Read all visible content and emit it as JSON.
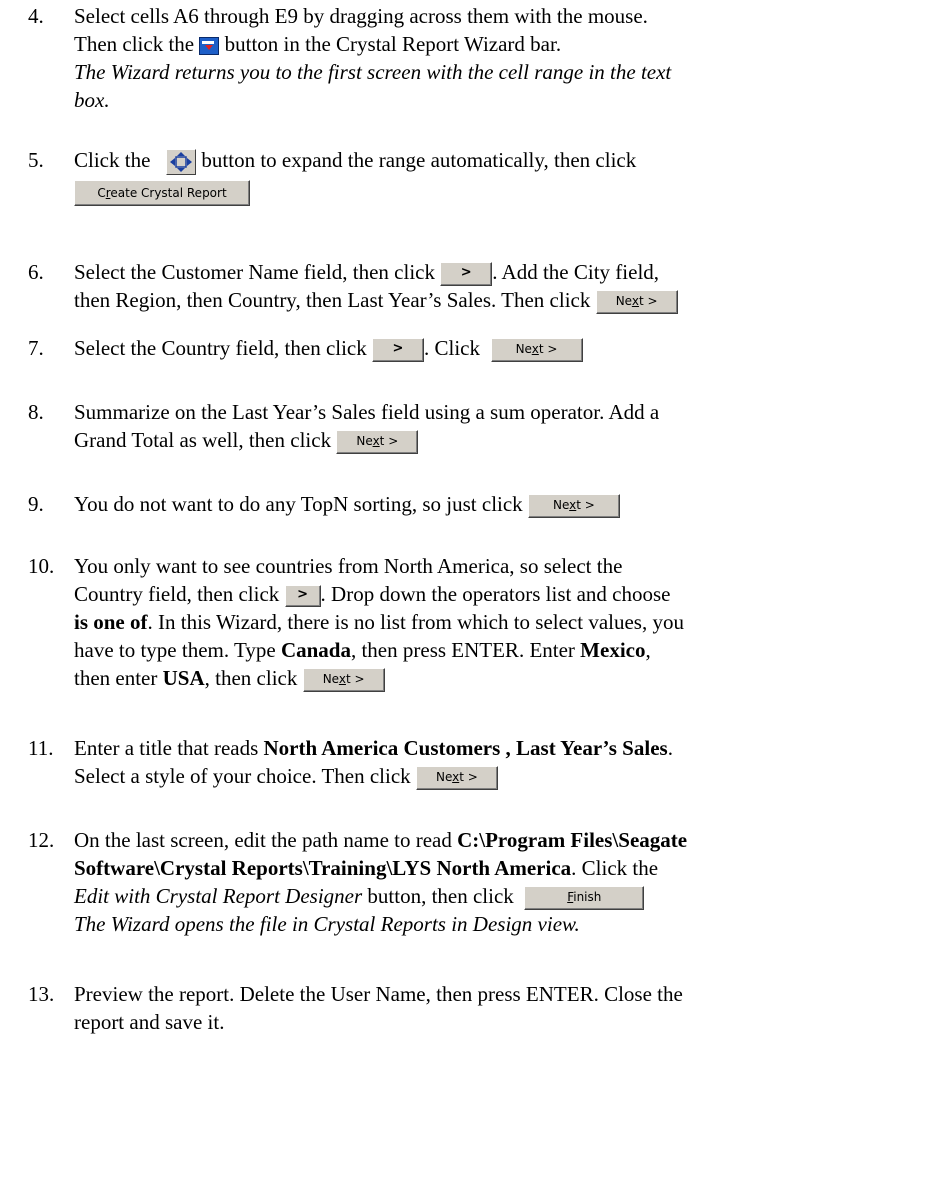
{
  "steps": [
    {
      "num": "4.",
      "l1": "Select cells A6 through E9 by dragging across them with the mouse.",
      "l2a": "Then click the",
      "l2b": "button in the Crystal Report Wizard bar.",
      "l3": "The Wizard returns you to the first screen with the cell range in the text",
      "l4": "box."
    },
    {
      "num": "5.",
      "l1a": "Click the",
      "l1b": "button to expand the range automatically, then click"
    },
    {
      "num": "6.",
      "l1a": "Select the Customer Name field, then click",
      "l1b": ".  Add the City field,",
      "l2": "then Region, then Country, then Last Year’s Sales. Then click"
    },
    {
      "num": "7.",
      "l1a": "Select the Country field, then click",
      "l1b": ". Click"
    },
    {
      "num": "8.",
      "l1": "Summarize on the Last Year’s Sales field using a sum operator. Add a",
      "l2": "Grand Total as well, then click"
    },
    {
      "num": "9.",
      "l1": "You do not want to do any TopN sorting, so just click"
    },
    {
      "num": "10.",
      "l1": "You only want to see countries from North America, so select the",
      "l2a": "Country field, then click",
      "l2b": ".  Drop down the operators list and choose",
      "l3a": "is one of",
      "l3b": ". In this Wizard, there is no list from which to select values, you",
      "l4a": "have to type them. Type ",
      "l4b": "Canada",
      "l4c": ", then press ENTER. Enter ",
      "l4d": "Mexico",
      "l4e": ",",
      "l5a": "then enter ",
      "l5b": "USA",
      "l5c": ", then click"
    },
    {
      "num": "11.",
      "l1a": "Enter a title that reads ",
      "l1b": "North America Customers , Last Year’s Sales",
      "l1c": ".",
      "l2": "Select a style of your choice. Then click"
    },
    {
      "num": "12.",
      "l1a": "On the last screen, edit the path name to read ",
      "l1b": "C:\\Program Files\\Seagate",
      "l2a": "Software\\Crystal Reports\\Training\\LYS North America",
      "l2b": ". Click the",
      "l3a": "Edit with Crystal Report Designer",
      "l3b": " button, then click",
      "l4": "The Wizard opens the file in Crystal Reports in Design view."
    },
    {
      "num": "13.",
      "l1": "Preview the report. Delete the User Name, then press ENTER. Close the",
      "l2": "report and save it."
    }
  ],
  "buttons": {
    "next_pre": "Ne",
    "next_u": "x",
    "next_post": "t >",
    "create_pre": "C",
    "create_u": "r",
    "create_post": "eate Crystal Report",
    "arrow": ">",
    "finish_u": "F",
    "finish_post": "inish"
  },
  "icons": {
    "wizard_bar": "report-wizard-icon",
    "expand": "expand-range-icon"
  }
}
